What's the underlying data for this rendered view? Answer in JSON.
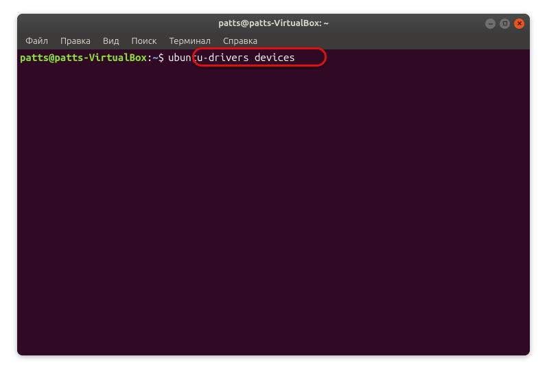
{
  "window": {
    "title": "patts@patts-VirtualBox: ~"
  },
  "menubar": {
    "items": [
      {
        "label": "Файл"
      },
      {
        "label": "Правка"
      },
      {
        "label": "Вид"
      },
      {
        "label": "Поиск"
      },
      {
        "label": "Терминал"
      },
      {
        "label": "Справка"
      }
    ]
  },
  "terminal": {
    "prompt": {
      "user_host": "patts@patts-VirtualBox",
      "colon": ":",
      "path": "~",
      "symbol": "$"
    },
    "command": "ubuntu-drivers devices"
  },
  "window_controls": {
    "minimize": "minimize",
    "maximize": "maximize",
    "close": "close"
  }
}
